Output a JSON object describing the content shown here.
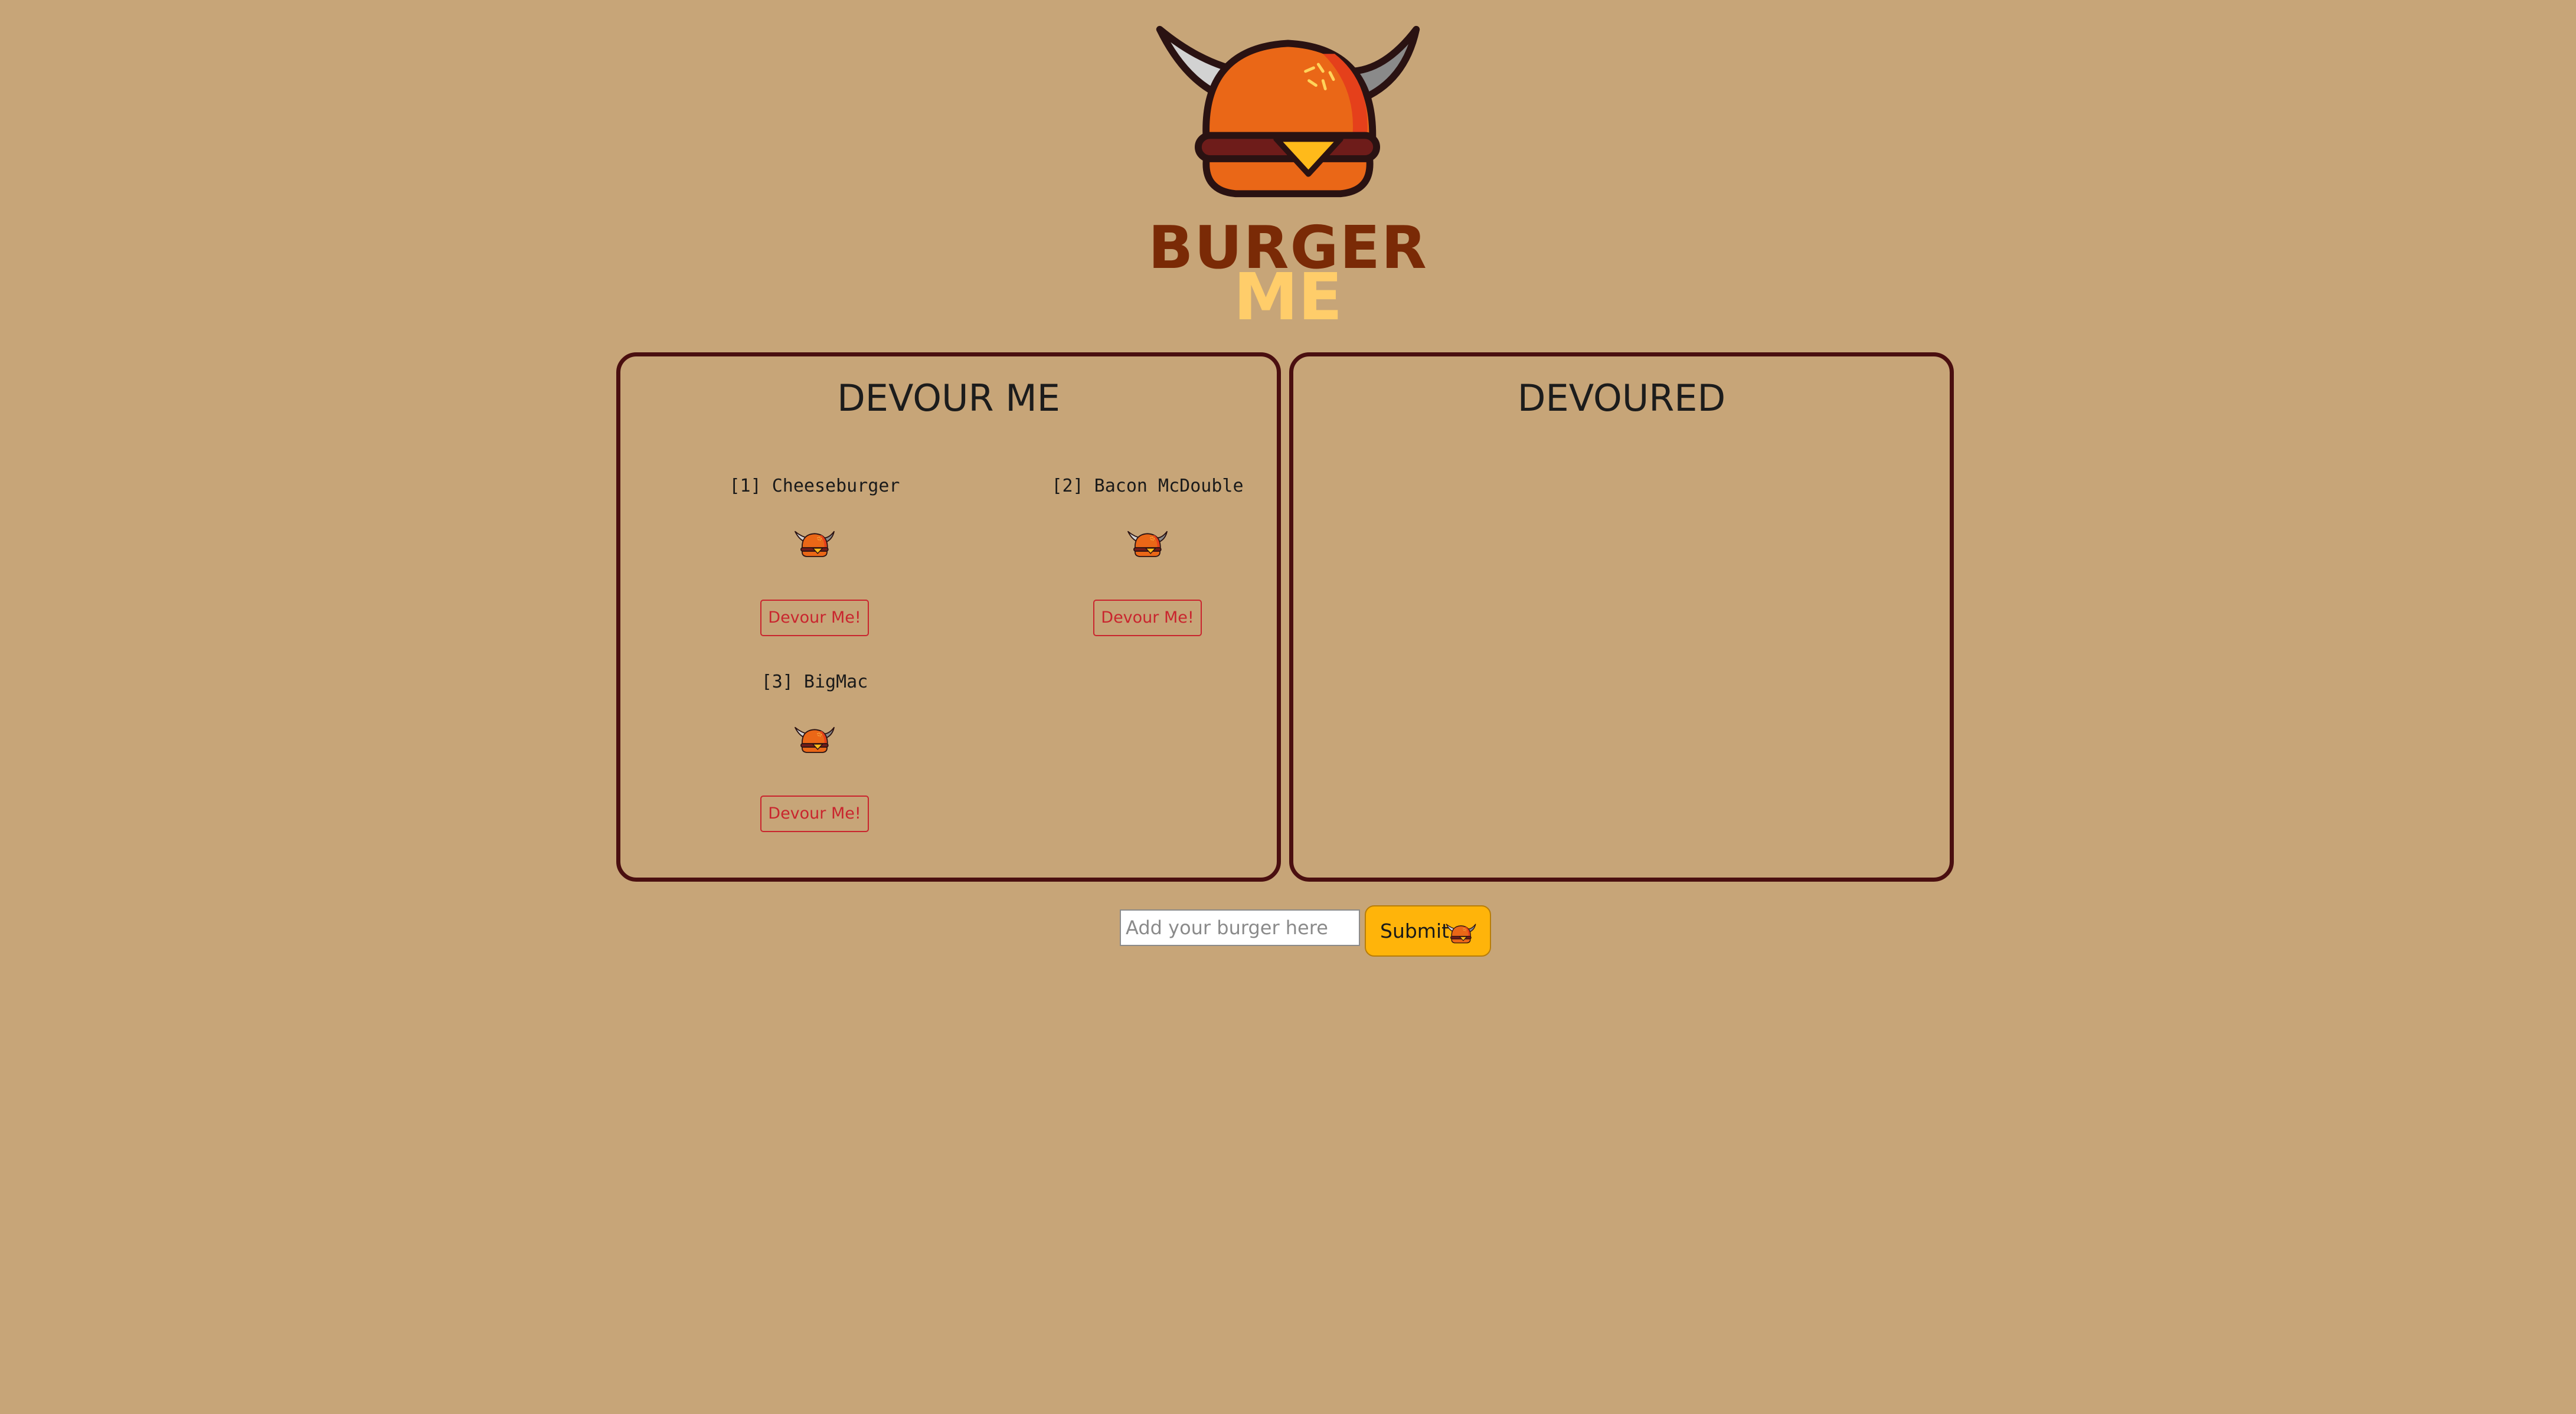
{
  "logo": {
    "line1": "BURGER",
    "line2": "ME",
    "icon": "horned-burger-icon"
  },
  "devour_panel": {
    "title": "DEVOUR ME",
    "items": [
      {
        "name": "[1] Cheeseburger",
        "button_label": "Devour Me!",
        "icon": "horned-burger-icon"
      },
      {
        "name": "[2] Bacon McDouble",
        "button_label": "Devour Me!",
        "icon": "horned-burger-icon"
      },
      {
        "name": "[3] BigMac",
        "button_label": "Devour Me!",
        "icon": "horned-burger-icon"
      }
    ]
  },
  "devoured_panel": {
    "title": "DEVOURED",
    "items": []
  },
  "form": {
    "placeholder": "Add your burger here",
    "value": "",
    "submit_label": "Submit",
    "submit_icon": "horned-burger-icon"
  },
  "colors": {
    "background": "#c7a578",
    "panel_border": "#4a0f10",
    "button_accent": "#c9252e",
    "submit_bg": "#ffb40a",
    "logo_dark": "#7a2a06",
    "logo_light": "#ffcd6a"
  }
}
